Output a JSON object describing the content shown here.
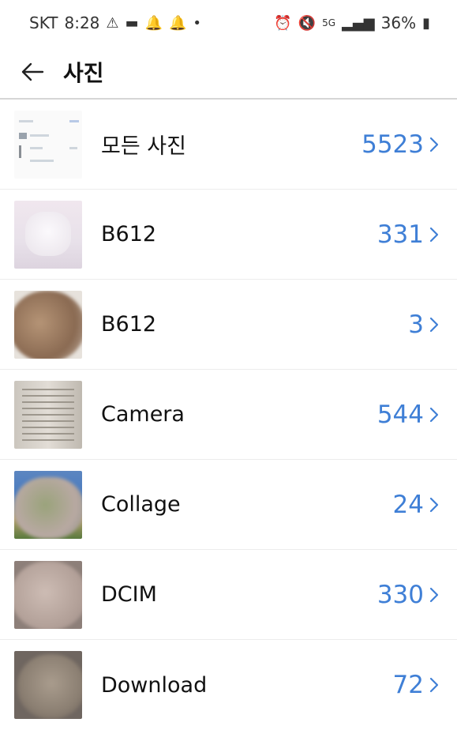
{
  "status_bar": {
    "carrier": "SKT",
    "time": "8:28",
    "battery": "36%"
  },
  "header": {
    "title": "사진"
  },
  "albums": [
    {
      "name": "모든 사진",
      "count": "5523",
      "thumb": "screenshot-thumbnail"
    },
    {
      "name": "B612",
      "count": "331",
      "thumb": "pink-photo-thumbnail"
    },
    {
      "name": "B612",
      "count": "3",
      "thumb": "blurred-photo-thumbnail"
    },
    {
      "name": "Camera",
      "count": "544",
      "thumb": "book-page-thumbnail"
    },
    {
      "name": "Collage",
      "count": "24",
      "thumb": "blurred-collage-thumbnail"
    },
    {
      "name": "DCIM",
      "count": "330",
      "thumb": "blurred-photo-thumbnail"
    },
    {
      "name": "Download",
      "count": "72",
      "thumb": "blurred-photo-thumbnail"
    }
  ],
  "colors": {
    "count": "#3f7fd6",
    "divider": "#d6d6d6"
  }
}
